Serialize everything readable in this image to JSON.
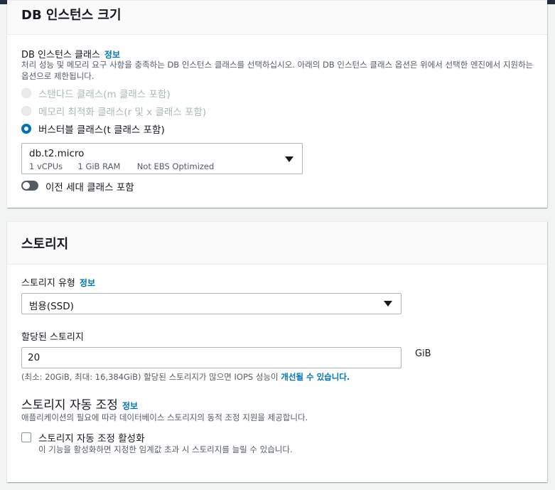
{
  "instance_class": {
    "title": "DB 인스턴스 크기",
    "field_label": "DB 인스턴스 클래스",
    "info": "정보",
    "description": "처리 성능 및 메모리 요구 사항을 충족하는 DB 인스턴스 클래스를 선택하십시오. 아래의 DB 인스턴스 클래스 옵션은 위에서 선택한 엔진에서 지원하는 옵션으로 제한됩니다.",
    "options": [
      {
        "label": "스탠다드 클래스(m 클래스 포함)",
        "state": "disabled"
      },
      {
        "label": "메모리 최적화 클래스(r 및 x 클래스 포함)",
        "state": "disabled"
      },
      {
        "label": "버스터블 클래스(t 클래스 포함)",
        "state": "selected"
      }
    ],
    "select": {
      "value": "db.t2.micro",
      "vcpu": "1 vCPUs",
      "ram": "1 GiB RAM",
      "ebs": "Not EBS Optimized"
    },
    "toggle_label": "이전 세대 클래스 포함",
    "toggle_on": false
  },
  "storage": {
    "title": "스토리지",
    "type_label": "스토리지 유형",
    "info": "정보",
    "type_value": "범용(SSD)",
    "allocated_label": "할당된 스토리지",
    "allocated_value": "20",
    "unit": "GiB",
    "constraint_text": "(최소: 20GiB, 최대: 16,384GiB) 할당된 스토리지가 많으면 IOPS 성능이 ",
    "constraint_link": "개선될 수 있습니다.",
    "autoscaling": {
      "title": "스토리지 자동 조정",
      "info": "정보",
      "description": "애플리케이션의 필요에 따라 데이터베이스 스토리지의 동적 조정 지원을 제공합니다.",
      "checkbox_label": "스토리지 자동 조정 활성화",
      "checkbox_checked": false,
      "checkbox_description": "이 기능을 활성화하면 지정한 임계값 초과 시 스토리지를 늘릴 수 있습니다."
    }
  }
}
